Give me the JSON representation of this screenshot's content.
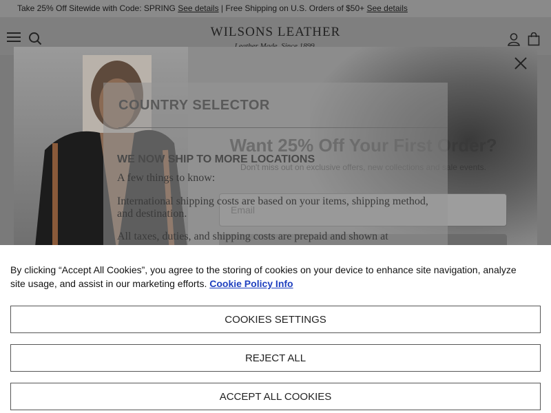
{
  "promo": {
    "text_a": "Take 25% Off Sitewide with Code: SPRING ",
    "link_a": "See details",
    "text_b": " | Free Shipping on U.S. Orders of $50+ ",
    "link_b": "See details"
  },
  "header": {
    "brand": "WILSONS LEATHER",
    "tagline": "Leather Made. Since 1899.",
    "icons": [
      "menu-icon",
      "search-icon",
      "user-icon",
      "bag-icon"
    ]
  },
  "country_selector": {
    "title": "COUNTRY SELECTOR",
    "heading": "WE NOW SHIP TO MORE LOCATIONS",
    "intro": "A few things to know:",
    "para1": "International shipping costs are based on your items, shipping method, and destination.",
    "para2": "All taxes, duties, and shipping costs are prepaid and shown at"
  },
  "signup": {
    "title": "Want 25% Off Your First Order?",
    "subtitle": "Don't miss out on exclusive offers, new collections and sale events.",
    "email_placeholder": "Email"
  },
  "cookies": {
    "text": "By clicking “Accept All Cookies”, you agree to the storing of cookies on your device to enhance site navigation, analyze site usage, and assist in our marketing efforts.",
    "policy_link": "Cookie Policy Info",
    "settings_label": "COOKIES SETTINGS",
    "reject_label": "REJECT ALL",
    "accept_label": "ACCEPT ALL COOKIES"
  }
}
